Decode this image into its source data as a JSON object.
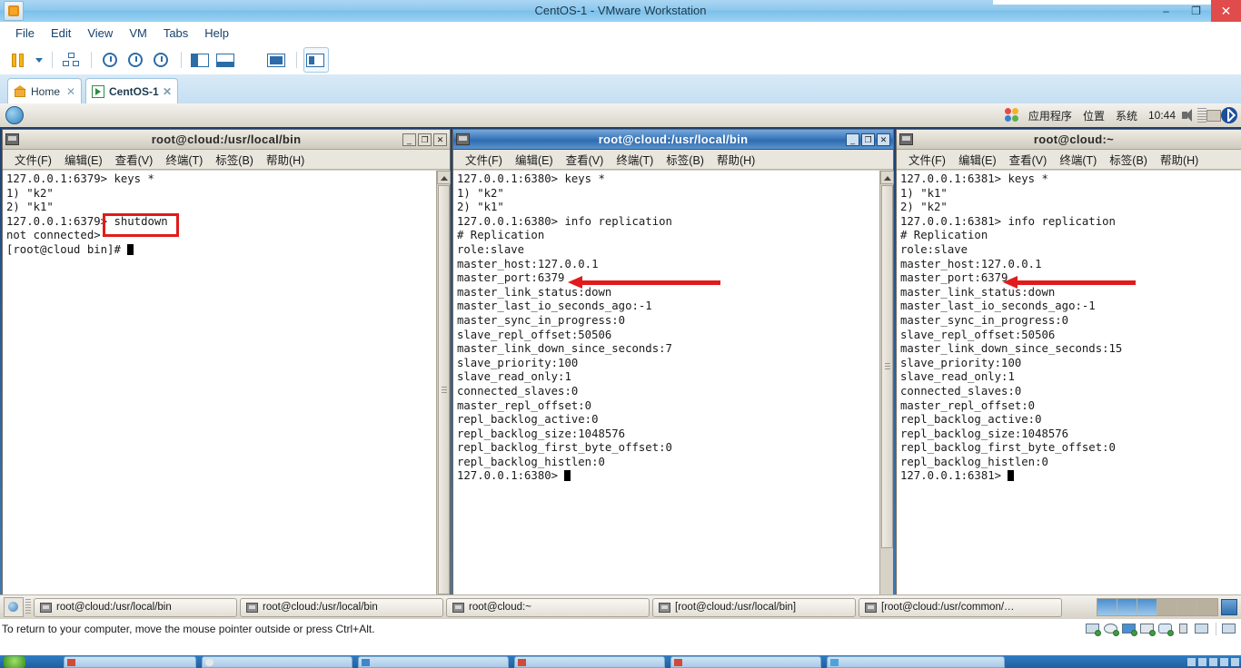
{
  "vmware": {
    "title": "CentOS-1 - VMware Workstation",
    "window_buttons": {
      "minimize": "–",
      "restore": "❐",
      "close": "✕"
    },
    "menu": [
      "File",
      "Edit",
      "View",
      "VM",
      "Tabs",
      "Help"
    ],
    "toolbar_icons": [
      "pause-icon",
      "dropdown-caret-icon",
      "snapshot-manager-icon",
      "take-snapshot-icon",
      "revert-snapshot-icon",
      "snapshot-options-icon",
      "show-sidebar-icon",
      "show-console-view-icon",
      "fullscreen-icon",
      "unity-mode-icon",
      "show-thumbnails-icon"
    ],
    "tabs": [
      {
        "label": "Home",
        "icon": "home-icon",
        "close": "✕",
        "active": false
      },
      {
        "label": "CentOS-1",
        "icon": "vm-powered-on-icon",
        "close": "✕",
        "active": true
      }
    ],
    "status_text": "To return to your computer, move the mouse pointer outside or press Ctrl+Alt.",
    "status_icons": [
      "hard-disk-icon",
      "cd-drive-icon",
      "network-adapter-icon",
      "printer-icon",
      "sound-card-icon",
      "usb-icon",
      "display-icon",
      "message-log-icon"
    ]
  },
  "gnome_panel": {
    "menus": [
      "应用程序",
      "位置",
      "系统"
    ],
    "clock": "10:44",
    "icons": [
      "gnome-foot-icon",
      "volume-icon",
      "signal-bars-icon",
      "archive-icon",
      "bluetooth-icon"
    ]
  },
  "terminals": [
    {
      "id": "term-1",
      "title": "root@cloud:/usr/local/bin",
      "active": false,
      "menu": [
        "文件(F)",
        "编辑(E)",
        "查看(V)",
        "终端(T)",
        "标签(B)",
        "帮助(H)"
      ],
      "buttons": {
        "minimize": "_",
        "maximize": "❐",
        "close": "✕"
      },
      "lines": [
        "127.0.0.1:6379> keys *",
        "1) \"k2\"",
        "2) \"k1\"",
        "127.0.0.1:6379> shutdown",
        "not connected>",
        "[root@cloud bin]# "
      ],
      "cursor_line": 5
    },
    {
      "id": "term-2",
      "title": "root@cloud:/usr/local/bin",
      "active": true,
      "menu": [
        "文件(F)",
        "编辑(E)",
        "查看(V)",
        "终端(T)",
        "标签(B)",
        "帮助(H)"
      ],
      "buttons": {
        "minimize": "_",
        "maximize": "❐",
        "close": "✕"
      },
      "lines": [
        "127.0.0.1:6380> keys *",
        "1) \"k2\"",
        "2) \"k1\"",
        "127.0.0.1:6380> info replication",
        "# Replication",
        "role:slave",
        "master_host:127.0.0.1",
        "master_port:6379",
        "master_link_status:down",
        "master_last_io_seconds_ago:-1",
        "master_sync_in_progress:0",
        "slave_repl_offset:50506",
        "master_link_down_since_seconds:7",
        "slave_priority:100",
        "slave_read_only:1",
        "connected_slaves:0",
        "master_repl_offset:0",
        "repl_backlog_active:0",
        "repl_backlog_size:1048576",
        "repl_backlog_first_byte_offset:0",
        "repl_backlog_histlen:0",
        "127.0.0.1:6380> "
      ],
      "cursor_line": 21
    },
    {
      "id": "term-3",
      "title": "root@cloud:~",
      "active": false,
      "menu": [
        "文件(F)",
        "编辑(E)",
        "查看(V)",
        "终端(T)",
        "标签(B)",
        "帮助(H)"
      ],
      "buttons": {
        "minimize": "_",
        "maximize": "❐",
        "close": "✕"
      },
      "lines": [
        "127.0.0.1:6381> keys *",
        "1) \"k1\"",
        "2) \"k2\"",
        "127.0.0.1:6381> info replication",
        "# Replication",
        "role:slave",
        "master_host:127.0.0.1",
        "master_port:6379",
        "master_link_status:down",
        "master_last_io_seconds_ago:-1",
        "master_sync_in_progress:0",
        "slave_repl_offset:50506",
        "master_link_down_since_seconds:15",
        "slave_priority:100",
        "slave_read_only:1",
        "connected_slaves:0",
        "master_repl_offset:0",
        "repl_backlog_active:0",
        "repl_backlog_size:1048576",
        "repl_backlog_first_byte_offset:0",
        "repl_backlog_histlen:0",
        "127.0.0.1:6381> "
      ],
      "cursor_line": 21
    }
  ],
  "annotations": {
    "color": "#e11b1b",
    "highlight_box_target": "shutdown",
    "arrow_targets": [
      "master_port:6379 (term-2)",
      "master_port:6379 (term-3)"
    ]
  },
  "gnome_taskbar": {
    "tasks": [
      "root@cloud:/usr/local/bin",
      "root@cloud:/usr/local/bin",
      "root@cloud:~",
      "[root@cloud:/usr/local/bin]",
      "[root@cloud:/usr/common/…"
    ],
    "workspaces": 6,
    "active_workspaces": [
      0,
      1,
      2
    ],
    "trash_icon": "trash-icon"
  }
}
